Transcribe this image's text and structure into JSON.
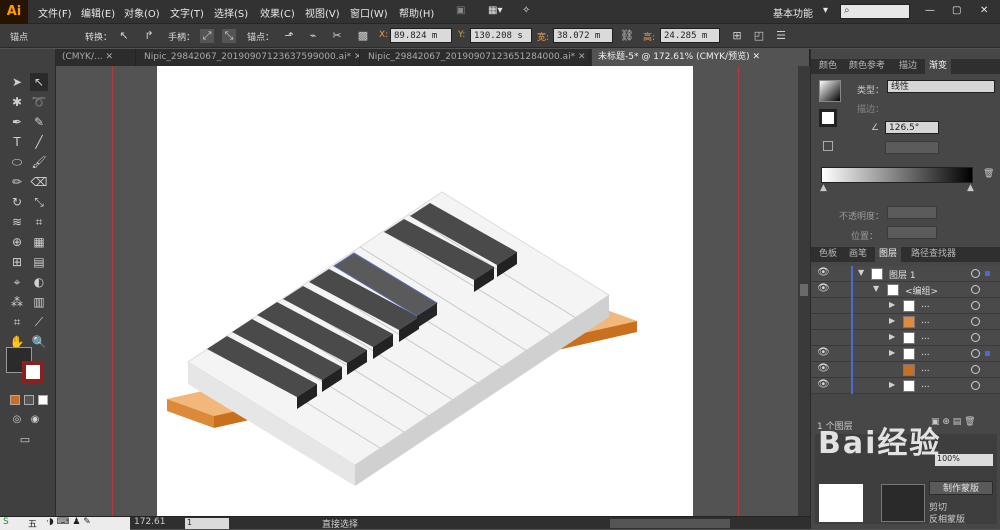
{
  "app": {
    "logo": "Ai"
  },
  "menu": [
    "文件(F)",
    "编辑(E)",
    "对象(O)",
    "文字(T)",
    "选择(S)",
    "效果(C)",
    "视图(V)",
    "窗口(W)",
    "帮助(H)"
  ],
  "workspace": "基本功能",
  "control": {
    "mode_label": "锚点",
    "convert_label": "转换：",
    "handle_label": "手柄：",
    "anchor_label": "锚点：",
    "x_label": "X:",
    "x_value": "89.824 m",
    "y_label": "Y:",
    "y_value": "130.208 s",
    "w_label": "宽:",
    "w_value": "38.072 m",
    "h_label": "高:",
    "h_value": "24.285 m"
  },
  "tabs": [
    {
      "label": "(CMYK/...",
      "active": false
    },
    {
      "label": "Nipic_29842067_20190907123637599000.ai*",
      "active": false
    },
    {
      "label": "Nipic_29842067_20190907123651284000.ai*",
      "active": false
    },
    {
      "label": "未标题-5* @ 172.61% (CMYK/预览)",
      "active": true
    }
  ],
  "panels": {
    "top_tabs": [
      "颜色",
      "颜色参考",
      "描边",
      "渐变"
    ],
    "gradient": {
      "type_label": "类型：",
      "type_value": "线性",
      "stroke_label": "描边：",
      "angle_value": "126.5°",
      "opacity_label": "不透明度：",
      "location_label": "位置："
    },
    "layer_tabs": [
      "色板",
      "画笔",
      "图层",
      "路径查找器"
    ],
    "layers": [
      {
        "name": "图层 1",
        "indent": 0
      },
      {
        "name": "<编组>",
        "indent": 1
      },
      {
        "name": "...",
        "indent": 2
      },
      {
        "name": "...",
        "indent": 2
      },
      {
        "name": "...",
        "indent": 2
      },
      {
        "name": "...",
        "indent": 2
      },
      {
        "name": "...",
        "indent": 2
      },
      {
        "name": "...",
        "indent": 2
      }
    ],
    "layer_count": "1 个图层",
    "make_mask": "制作蒙版",
    "clip": "剪切",
    "invert_mask": "反相蒙版",
    "percent": "100%"
  },
  "status": {
    "zoom": "172.61",
    "page": "1",
    "tool": "直接选择"
  },
  "taskbar": {
    "ime": "五"
  },
  "watermark": "Bai经验",
  "colors": {
    "fill": "#2b2b2b",
    "key_white": "#f2f2f2",
    "key_black": "#3f3f3f",
    "base_orange": "#e8a35c"
  }
}
